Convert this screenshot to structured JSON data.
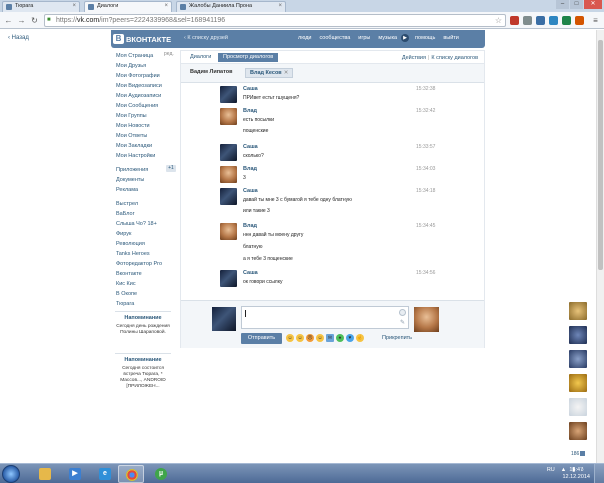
{
  "browser": {
    "tabs": [
      {
        "label": "Тюрага",
        "active": false
      },
      {
        "label": "Диалоги",
        "active": true
      },
      {
        "label": "Жалобы Даниила Прона",
        "active": false
      }
    ],
    "url_scheme": "https://",
    "url_host": "vk.com",
    "url_path": "/im?peers=2224339968&sel=168941196",
    "window_buttons": [
      "–",
      "□",
      "✕"
    ]
  },
  "back_link": "Назад",
  "header": {
    "logo_letter": "В",
    "logo_text": "ВКОНТАКТЕ",
    "search_link": "К списку друзей",
    "nav": [
      "люди",
      "сообщества",
      "игры",
      "музыка",
      "помощь",
      "выйти"
    ]
  },
  "left_menu": {
    "items": [
      "Моя Страница",
      "Мои Друзья",
      "Мои Фотографии",
      "Мои Видеозаписи",
      "Мои Аудиозаписи",
      "Мои Сообщения",
      "Мои Группы",
      "Мои Новости",
      "Мои Ответы",
      "Мои Закладки",
      "Мои Настройки"
    ],
    "edit_label": "ред.",
    "apps_label": "Приложения",
    "apps_badge": "+1",
    "items2": [
      "Документы",
      "Реклама"
    ],
    "apps": [
      "Выстрел",
      "ВаБлог",
      "Слыша Чо? 18+",
      "Фирук",
      "Революция",
      "Tanks Heroes",
      "Фоторедактор Pro",
      "Вконтакте",
      "Кис Кис",
      "В Окопе",
      "Тюрага"
    ]
  },
  "reminders": [
    {
      "title": "Напоминание",
      "body": "Сегодня день рождения Полины Шараповой."
    },
    {
      "title": "Напоминание",
      "body": "Сегодня состоится встреча Тюрага, * Массов..., ANDROID [ПРИЛОЖЕН..."
    }
  ],
  "dialog": {
    "tabs": [
      "Диалоги",
      "Просмотр диалогов"
    ],
    "actions": [
      "Действия",
      "К списку диалогов"
    ],
    "peers": [
      {
        "name": "Вадим Липатов"
      },
      {
        "name": "Влад Кесов",
        "close": "✕"
      }
    ],
    "messages": [
      {
        "author": "Саша",
        "time": "15:32:38",
        "lines": [
          "ПРИвет естьт гшущеня?"
        ],
        "avatar": "dark"
      },
      {
        "author": "Влад",
        "time": "15:32:42",
        "lines": [
          "есть посылки",
          "пощенские"
        ],
        "avatar": "warm"
      },
      {
        "author": "Саша",
        "time": "15:33:57",
        "lines": [
          "сколько?"
        ],
        "avatar": "dark"
      },
      {
        "author": "Влад",
        "time": "15:34:03",
        "lines": [
          "3"
        ],
        "avatar": "warm"
      },
      {
        "author": "Саша",
        "time": "15:34:18",
        "lines": [
          "давай ты мне 3 с бумагой я тебе одну блатную",
          "или такие 3"
        ],
        "avatar": "dark"
      },
      {
        "author": "Влад",
        "time": "15:34:45",
        "lines": [
          "ннн давай ты моену другу",
          "блатную",
          "а я тебе 3 пощенские"
        ],
        "avatar": "warm"
      },
      {
        "author": "Саша",
        "time": "15:34:56",
        "lines": [
          "ок говори ссылку"
        ],
        "avatar": "dark"
      }
    ],
    "send_label": "Отправить",
    "attach_label": "Прикрепить",
    "emojis": [
      "☺",
      "☺",
      "☹",
      "☺",
      "✉",
      "♠",
      "♥",
      "☝"
    ]
  },
  "friends_count": "186",
  "taskbar": {
    "lang": "RU",
    "time": "15:47",
    "date": "12.12.2014"
  },
  "colors": {
    "vk_blue": "#5b7fa6",
    "link": "#2b587a"
  }
}
